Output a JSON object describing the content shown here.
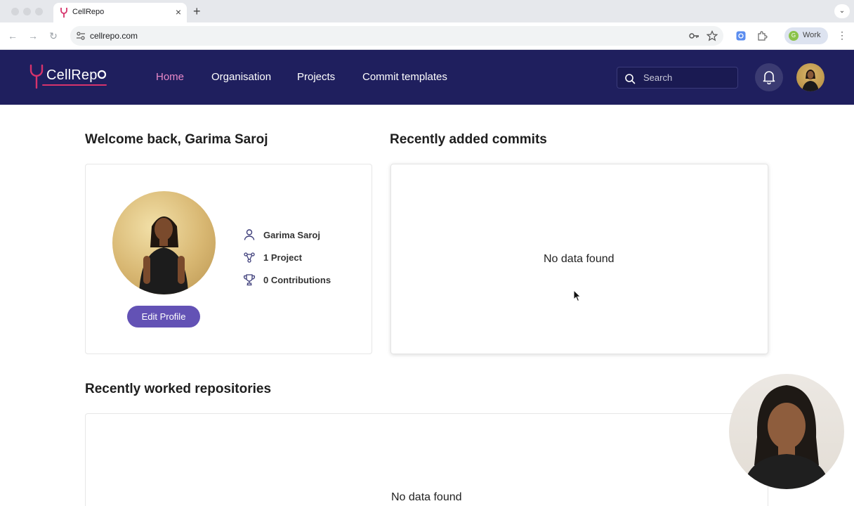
{
  "browser": {
    "tab_title": "CellRepo",
    "url": "cellrepo.com",
    "profile_label": "Work",
    "profile_initial": "G"
  },
  "app": {
    "logo_text": "CellRep",
    "nav": [
      "Home",
      "Organisation",
      "Projects",
      "Commit templates"
    ],
    "active_nav": "Home",
    "search_placeholder": "Search"
  },
  "welcome": {
    "heading": "Welcome back, Garima Saroj",
    "user_name": "Garima Saroj",
    "projects": "1 Project",
    "contributions": "0 Contributions",
    "edit_button": "Edit Profile"
  },
  "commits": {
    "heading": "Recently added commits",
    "empty_text": "No data found"
  },
  "repositories": {
    "heading": "Recently worked repositories",
    "empty_text": "No data found"
  },
  "colors": {
    "header_bg": "#1f1f5e",
    "active_nav": "#e889c8",
    "brand_pink": "#d6336c",
    "button": "#6352b5"
  }
}
